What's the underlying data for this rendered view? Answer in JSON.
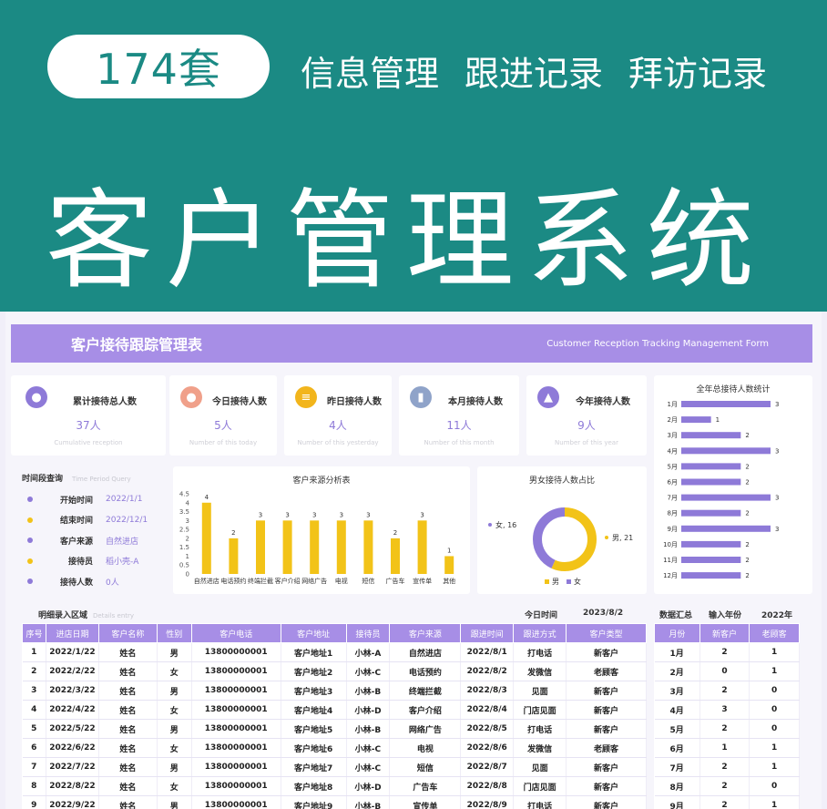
{
  "banner": {
    "count": "174套",
    "tags": [
      "信息管理",
      "跟进记录",
      "拜访记录"
    ],
    "title": "客户管理系统"
  },
  "dashboard": {
    "title_cn": "客户接待跟踪管理表",
    "title_en": "Customer Reception Tracking Management Form",
    "kpis": [
      {
        "label": "累计接待总人数",
        "value": "37人",
        "sub": "Cumulative reception",
        "icon": "users-icon",
        "color": "#8e7ad8"
      },
      {
        "label": "今日接待人数",
        "value": "5人",
        "sub": "Number of this today",
        "icon": "person-icon",
        "color": "#f0a08a"
      },
      {
        "label": "昨日接待人数",
        "value": "4人",
        "sub": "Number of this yesterday",
        "icon": "stack-icon",
        "color": "#f2b51c"
      },
      {
        "label": "本月接待人数",
        "value": "11人",
        "sub": "Number of this month",
        "icon": "bars-icon",
        "color": "#8fa3c9"
      },
      {
        "label": "今年接待人数",
        "value": "9人",
        "sub": "Number of this year",
        "icon": "chart-icon",
        "color": "#8e7ad8"
      }
    ],
    "query": {
      "title": "时间段查询",
      "title_en": "Time Period Query",
      "rows": [
        {
          "k": "开始时间",
          "v": "2022/1/1",
          "dot": "#8e7ad8"
        },
        {
          "k": "结束时间",
          "v": "2022/12/1",
          "dot": "#f2c318"
        },
        {
          "k": "客户来源",
          "v": "自然进店",
          "dot": "#8e7ad8"
        },
        {
          "k": "接待员",
          "v": "稻小壳-A",
          "dot": "#f2c318"
        },
        {
          "k": "接待人数",
          "v": "0人",
          "dot": "#8e7ad8"
        }
      ]
    },
    "source_title": "客户来源分析表",
    "gender_title": "男女接待人数占比",
    "yearly_title": "全年总接待人数统计",
    "detail": {
      "title": "明细录入区域",
      "title_en": "Details entry",
      "today_label": "今日时间",
      "today_value": "2023/8/2",
      "headers": [
        "序号",
        "进店日期",
        "客户名称",
        "性别",
        "客户电话",
        "客户地址",
        "接待员",
        "客户来源",
        "跟进时间",
        "跟进方式",
        "客户类型"
      ],
      "rows": [
        [
          "1",
          "2022/1/22",
          "姓名",
          "男",
          "13800000001",
          "客户地址1",
          "小林-A",
          "自然进店",
          "2022/8/1",
          "打电话",
          "新客户"
        ],
        [
          "2",
          "2022/2/22",
          "姓名",
          "女",
          "13800000001",
          "客户地址2",
          "小林-C",
          "电话预约",
          "2022/8/2",
          "发微信",
          "老顾客"
        ],
        [
          "3",
          "2022/3/22",
          "姓名",
          "男",
          "13800000001",
          "客户地址3",
          "小林-B",
          "终端拦截",
          "2022/8/3",
          "见面",
          "新客户"
        ],
        [
          "4",
          "2022/4/22",
          "姓名",
          "女",
          "13800000001",
          "客户地址4",
          "小林-D",
          "客户介绍",
          "2022/8/4",
          "门店见面",
          "新客户"
        ],
        [
          "5",
          "2022/5/22",
          "姓名",
          "男",
          "13800000001",
          "客户地址5",
          "小林-B",
          "网络广告",
          "2022/8/5",
          "打电话",
          "新客户"
        ],
        [
          "6",
          "2022/6/22",
          "姓名",
          "女",
          "13800000001",
          "客户地址6",
          "小林-C",
          "电视",
          "2022/8/6",
          "发微信",
          "老顾客"
        ],
        [
          "7",
          "2022/7/22",
          "姓名",
          "男",
          "13800000001",
          "客户地址7",
          "小林-C",
          "短信",
          "2022/8/7",
          "见面",
          "新客户"
        ],
        [
          "8",
          "2022/8/22",
          "姓名",
          "女",
          "13800000001",
          "客户地址8",
          "小林-D",
          "广告车",
          "2022/8/8",
          "门店见面",
          "新客户"
        ],
        [
          "9",
          "2022/9/22",
          "姓名",
          "男",
          "13800000001",
          "客户地址9",
          "小林-B",
          "宣传单",
          "2022/8/9",
          "打电话",
          "新客户"
        ]
      ]
    },
    "summary": {
      "title": "数据汇总",
      "year_label": "输入年份",
      "year_value": "2022年",
      "headers": [
        "月份",
        "新客户",
        "老顾客"
      ],
      "rows": [
        [
          "1月",
          "2",
          "1"
        ],
        [
          "2月",
          "0",
          "1"
        ],
        [
          "3月",
          "2",
          "0"
        ],
        [
          "4月",
          "3",
          "0"
        ],
        [
          "5月",
          "2",
          "0"
        ],
        [
          "6月",
          "1",
          "1"
        ],
        [
          "7月",
          "2",
          "1"
        ],
        [
          "8月",
          "2",
          "0"
        ],
        [
          "9月",
          "2",
          "1"
        ]
      ]
    }
  },
  "chart_data": [
    {
      "type": "bar",
      "title": "客户来源分析表",
      "categories": [
        "自然进店",
        "电话预约",
        "终端拦截",
        "客户介绍",
        "网络广告",
        "电视",
        "短信",
        "广告车",
        "宣传单",
        "其他"
      ],
      "values": [
        4,
        2,
        3,
        3,
        3,
        3,
        3,
        2,
        3,
        1
      ],
      "ylim": [
        0,
        4.5
      ],
      "yticks": [
        "4.5",
        "4",
        "3.5",
        "3",
        "2.5",
        "2",
        "1.5",
        "1",
        "0.5",
        "0"
      ],
      "color": "#f2c318"
    },
    {
      "type": "pie",
      "title": "男女接待人数占比",
      "slices": [
        {
          "name": "男",
          "value": 21,
          "color": "#f2c318"
        },
        {
          "name": "女",
          "value": 16,
          "color": "#8e7ad8"
        }
      ],
      "label_female": "女, 16",
      "label_male": "男, 21"
    },
    {
      "type": "bar",
      "title": "全年总接待人数统计",
      "categories": [
        "1月",
        "2月",
        "3月",
        "4月",
        "5月",
        "6月",
        "7月",
        "8月",
        "9月",
        "10月",
        "11月",
        "12月"
      ],
      "values": [
        3,
        1,
        2,
        3,
        2,
        2,
        3,
        2,
        3,
        2,
        2,
        2
      ],
      "color": "#8e7ad8"
    }
  ]
}
